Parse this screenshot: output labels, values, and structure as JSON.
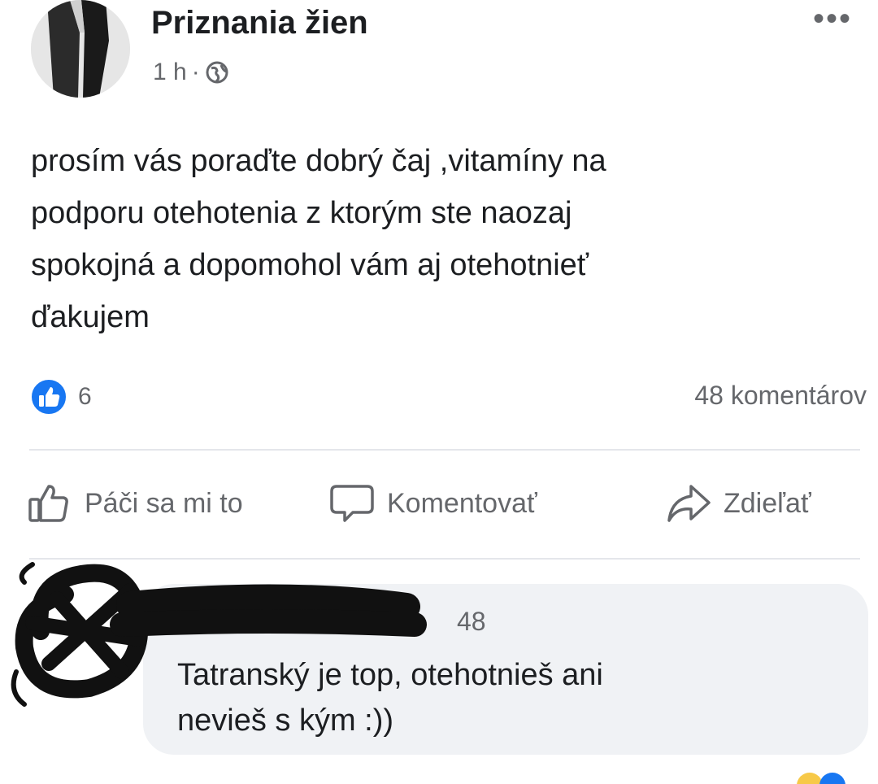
{
  "post": {
    "author": "Priznania žien",
    "time": "1 h",
    "separator": "·",
    "more_label": "•••",
    "text_lines": [
      "prosím vás poraďte dobrý čaj ,vitamíny na",
      "podporu otehotenia z ktorým ste naozaj",
      "spokojná a dopomohol vám aj otehotnieť",
      "ďakujem"
    ],
    "likes_count": "6",
    "comments_count": "48 komentárov"
  },
  "actions": {
    "like": "Páči sa mi to",
    "comment": "Komentovať",
    "share": "Zdieľať"
  },
  "comment": {
    "count_fragment": "48",
    "text_lines": [
      "Tatranský je top, otehotnieš ani",
      "nevieš s kým :))"
    ]
  },
  "colors": {
    "like_blue": "#1877f2",
    "secondary_text": "#65676b",
    "bubble": "#f0f2f5"
  },
  "icons": {
    "privacy": "globe-icon",
    "like_badge": "thumbs-up-badge-icon",
    "like": "thumbs-up-outline-icon",
    "comment": "speech-bubble-icon",
    "share": "share-arrow-icon",
    "menu": "more-options-icon"
  }
}
